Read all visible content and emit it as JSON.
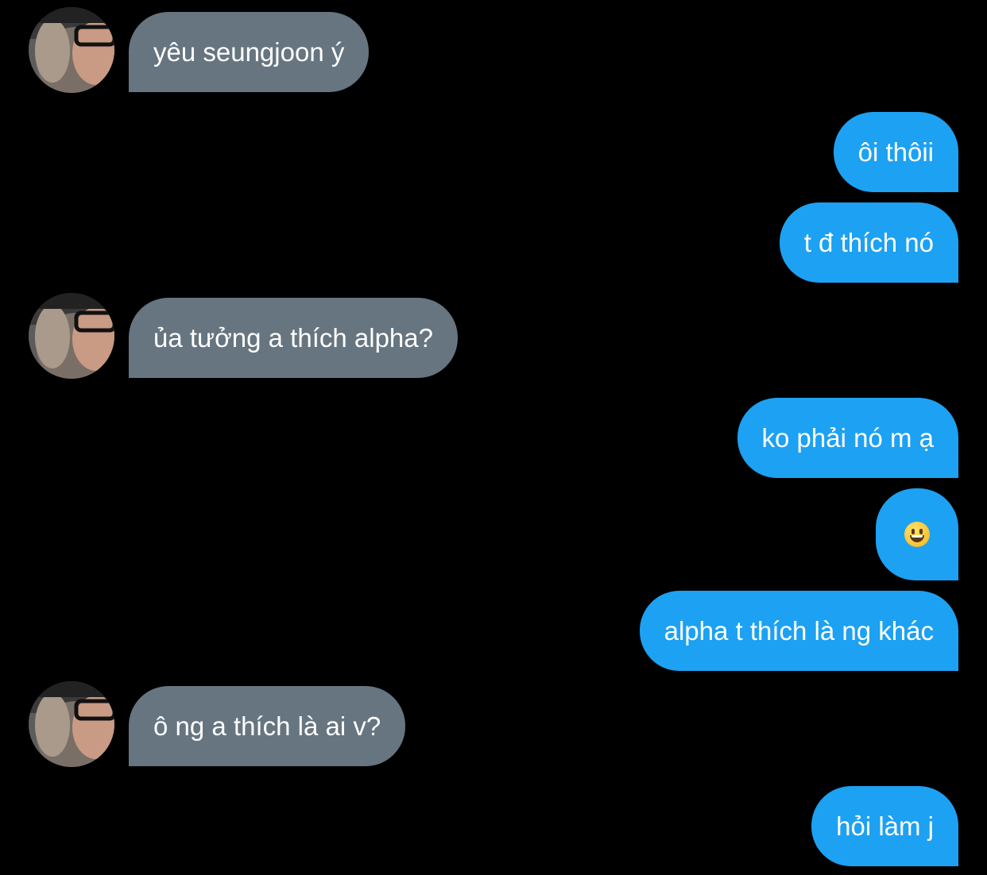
{
  "conversation": {
    "messages": [
      {
        "direction": "incoming",
        "text": "yêu seungjoon ý"
      },
      {
        "direction": "outgoing",
        "text": "ôi thôii"
      },
      {
        "direction": "outgoing",
        "text": "t đ thích nó"
      },
      {
        "direction": "incoming",
        "text": "ủa tưởng a thích alpha?"
      },
      {
        "direction": "outgoing",
        "text": "ko phải nó m ạ"
      },
      {
        "direction": "outgoing",
        "text": "",
        "emoji": "grinning-face-icon"
      },
      {
        "direction": "outgoing",
        "text": "alpha t thích là ng khác"
      },
      {
        "direction": "incoming",
        "text": "ô ng a thích là ai v?"
      },
      {
        "direction": "outgoing",
        "text": "hỏi làm j"
      }
    ]
  },
  "colors": {
    "background": "#000000",
    "incoming_bubble": "#66757f",
    "outgoing_bubble": "#1da1f2",
    "text": "#ffffff"
  }
}
